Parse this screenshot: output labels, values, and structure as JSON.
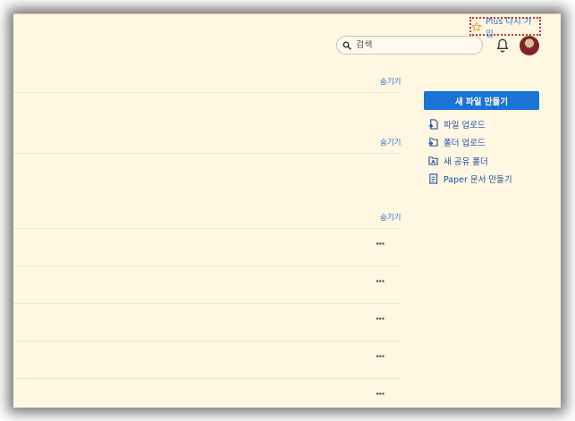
{
  "header": {
    "plus_link": "Plus 다시 가입",
    "search_placeholder": "검색"
  },
  "sections": [
    {
      "hide_label": "숨기기"
    },
    {
      "hide_label": "숨기기"
    },
    {
      "hide_label": "숨기기"
    }
  ],
  "rows": [
    {
      "more_label": "···"
    },
    {
      "more_label": "···"
    },
    {
      "more_label": "···"
    },
    {
      "more_label": "···"
    },
    {
      "more_label": "···"
    }
  ],
  "sidebar": {
    "new_file_label": "새 파일 만들기",
    "actions": [
      {
        "label": "파일 업로드",
        "icon": "file-upload-icon"
      },
      {
        "label": "폴더 업로드",
        "icon": "folder-upload-icon"
      },
      {
        "label": "새 공유 폴더",
        "icon": "shared-folder-icon"
      },
      {
        "label": "Paper 문서 만들기",
        "icon": "paper-doc-icon"
      }
    ]
  },
  "colors": {
    "accent": "#1a73d6",
    "link": "#2e6fc9",
    "background": "#fff7e2",
    "highlight_border": "#c0392b"
  }
}
